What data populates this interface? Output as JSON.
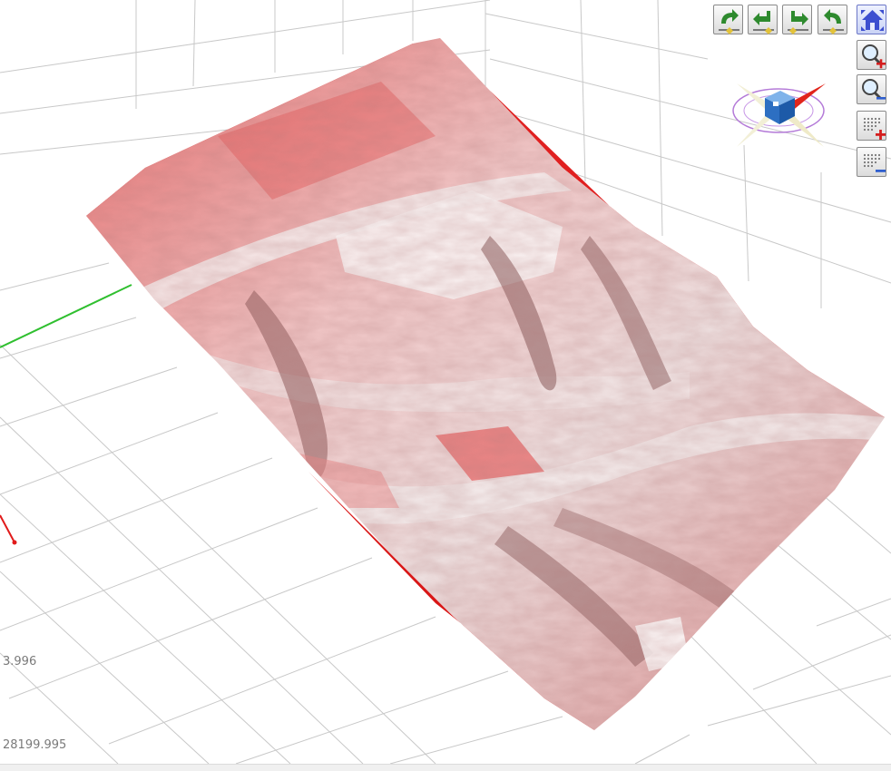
{
  "viewer": {
    "coord_label_1": "3.996",
    "coord_label_2": "28199.995"
  },
  "toolbar": {
    "buttons": [
      {
        "name": "rotate-left-button",
        "icon": "rotate-left-icon"
      },
      {
        "name": "rotate-down-left-button",
        "icon": "rotate-down-left-icon"
      },
      {
        "name": "rotate-down-right-button",
        "icon": "rotate-down-right-icon"
      },
      {
        "name": "rotate-right-button",
        "icon": "rotate-right-icon"
      },
      {
        "name": "home-view-button",
        "icon": "home-icon"
      }
    ],
    "zoom": [
      {
        "name": "zoom-in-button",
        "icon": "zoom-in-icon"
      },
      {
        "name": "zoom-out-button",
        "icon": "zoom-out-icon"
      },
      {
        "name": "point-density-increase-button",
        "icon": "grid-plus-icon"
      },
      {
        "name": "point-density-decrease-button",
        "icon": "grid-minus-icon"
      }
    ]
  },
  "colors": {
    "surface_red": "#e53b3b",
    "surface_light": "#f4dede",
    "grid": "#c8c8c8",
    "axis_green": "#2fbf2f",
    "axis_red": "#e11b1b"
  }
}
